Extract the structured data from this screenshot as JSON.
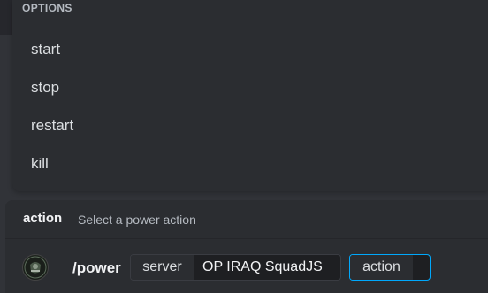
{
  "autocomplete": {
    "header": "OPTIONS",
    "options": [
      {
        "label": "start"
      },
      {
        "label": "stop"
      },
      {
        "label": "restart"
      },
      {
        "label": "kill"
      }
    ]
  },
  "parameter": {
    "name": "action",
    "description": "Select a power action"
  },
  "command": {
    "name": "/power",
    "app_icon": "app-avatar-icon",
    "options": {
      "server": {
        "key": "server",
        "value": "OP IRAQ SquadJS"
      },
      "action": {
        "key": "action",
        "value": ""
      }
    }
  },
  "colors": {
    "background": "#313338",
    "panel": "#2b2d31",
    "focus_border": "#00a8fc",
    "text": "#dbdee1"
  }
}
